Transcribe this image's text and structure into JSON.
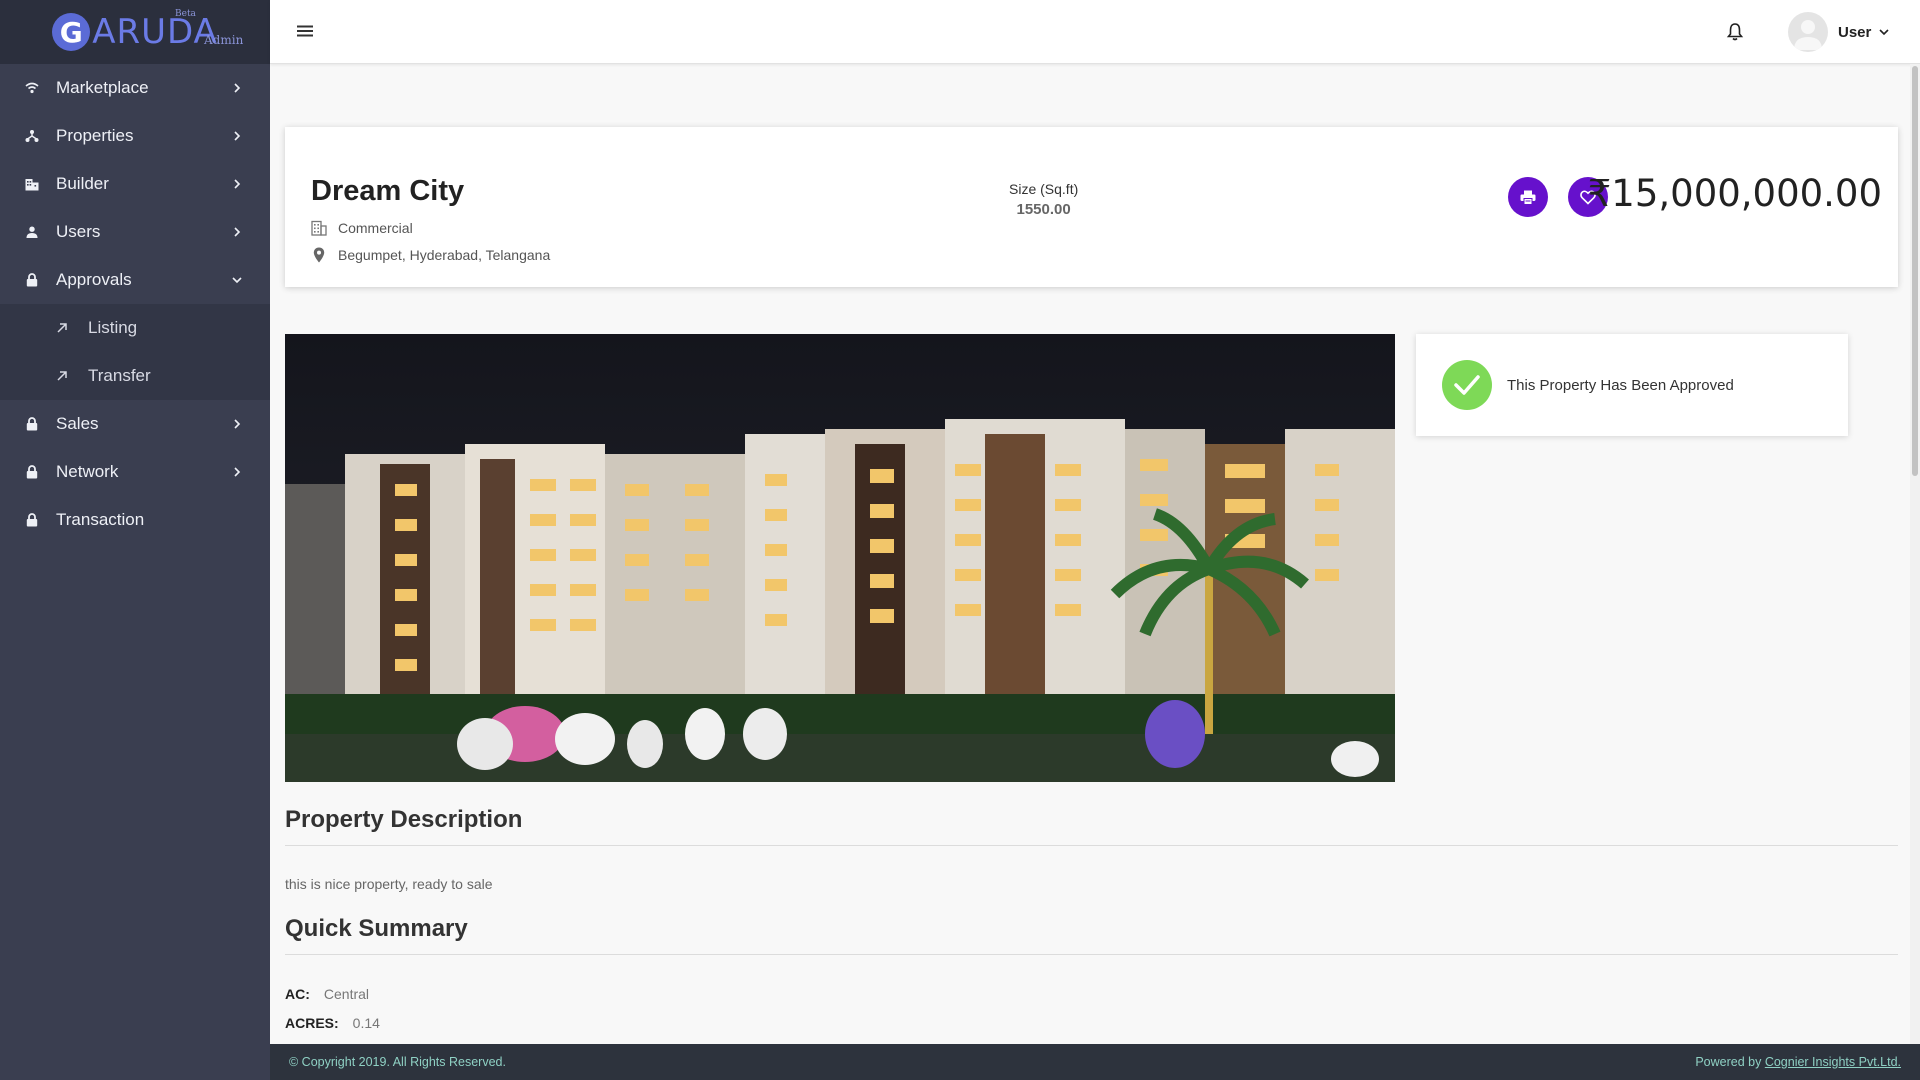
{
  "brand": {
    "letter": "G",
    "name": "ARUDA",
    "beta": "Beta",
    "suffix": "Admin"
  },
  "sidebar": {
    "items": [
      {
        "label": "Marketplace",
        "icon": "wifi-icon",
        "chevron": "right"
      },
      {
        "label": "Properties",
        "icon": "network-icon",
        "chevron": "right"
      },
      {
        "label": "Builder",
        "icon": "building-icon",
        "chevron": "right"
      },
      {
        "label": "Users",
        "icon": "person-icon",
        "chevron": "right"
      },
      {
        "label": "Approvals",
        "icon": "lock-icon",
        "chevron": "down",
        "expanded": true,
        "children": [
          {
            "label": "Listing",
            "icon": "arrow-up-right-icon"
          },
          {
            "label": "Transfer",
            "icon": "arrow-up-right-icon"
          }
        ]
      },
      {
        "label": "Sales",
        "icon": "lock-icon",
        "chevron": "right"
      },
      {
        "label": "Network",
        "icon": "lock-icon",
        "chevron": "right"
      },
      {
        "label": "Transaction",
        "icon": "lock-icon",
        "chevron": "none"
      }
    ]
  },
  "header": {
    "user_name": "User"
  },
  "property": {
    "title": "Dream City",
    "type": "Commercial",
    "location": "Begumpet, Hyderabad, Telangana",
    "size_label": "Size (Sq.ft)",
    "size_value": "1550.00",
    "price": "₹15,000,000.00",
    "status_text": "This Property Has Been Approved"
  },
  "description": {
    "heading": "Property Description",
    "text": "this is nice property, ready to sale"
  },
  "summary": {
    "heading": "Quick Summary",
    "rows": [
      {
        "key": "AC:",
        "value": "Central"
      },
      {
        "key": "ACRES:",
        "value": "0.14"
      }
    ]
  },
  "footer": {
    "copyright": "© Copyright 2019. All Rights Reserved.",
    "powered_prefix": "Powered by ",
    "powered_link": "Cognier Insights Pvt.Ltd."
  },
  "colors": {
    "sidebar_bg": "#3a3e50",
    "accent_purple": "#6611cc",
    "approved_green": "#7ed957",
    "footer_bg": "#2d333d",
    "footer_text": "#8fd1c4"
  }
}
